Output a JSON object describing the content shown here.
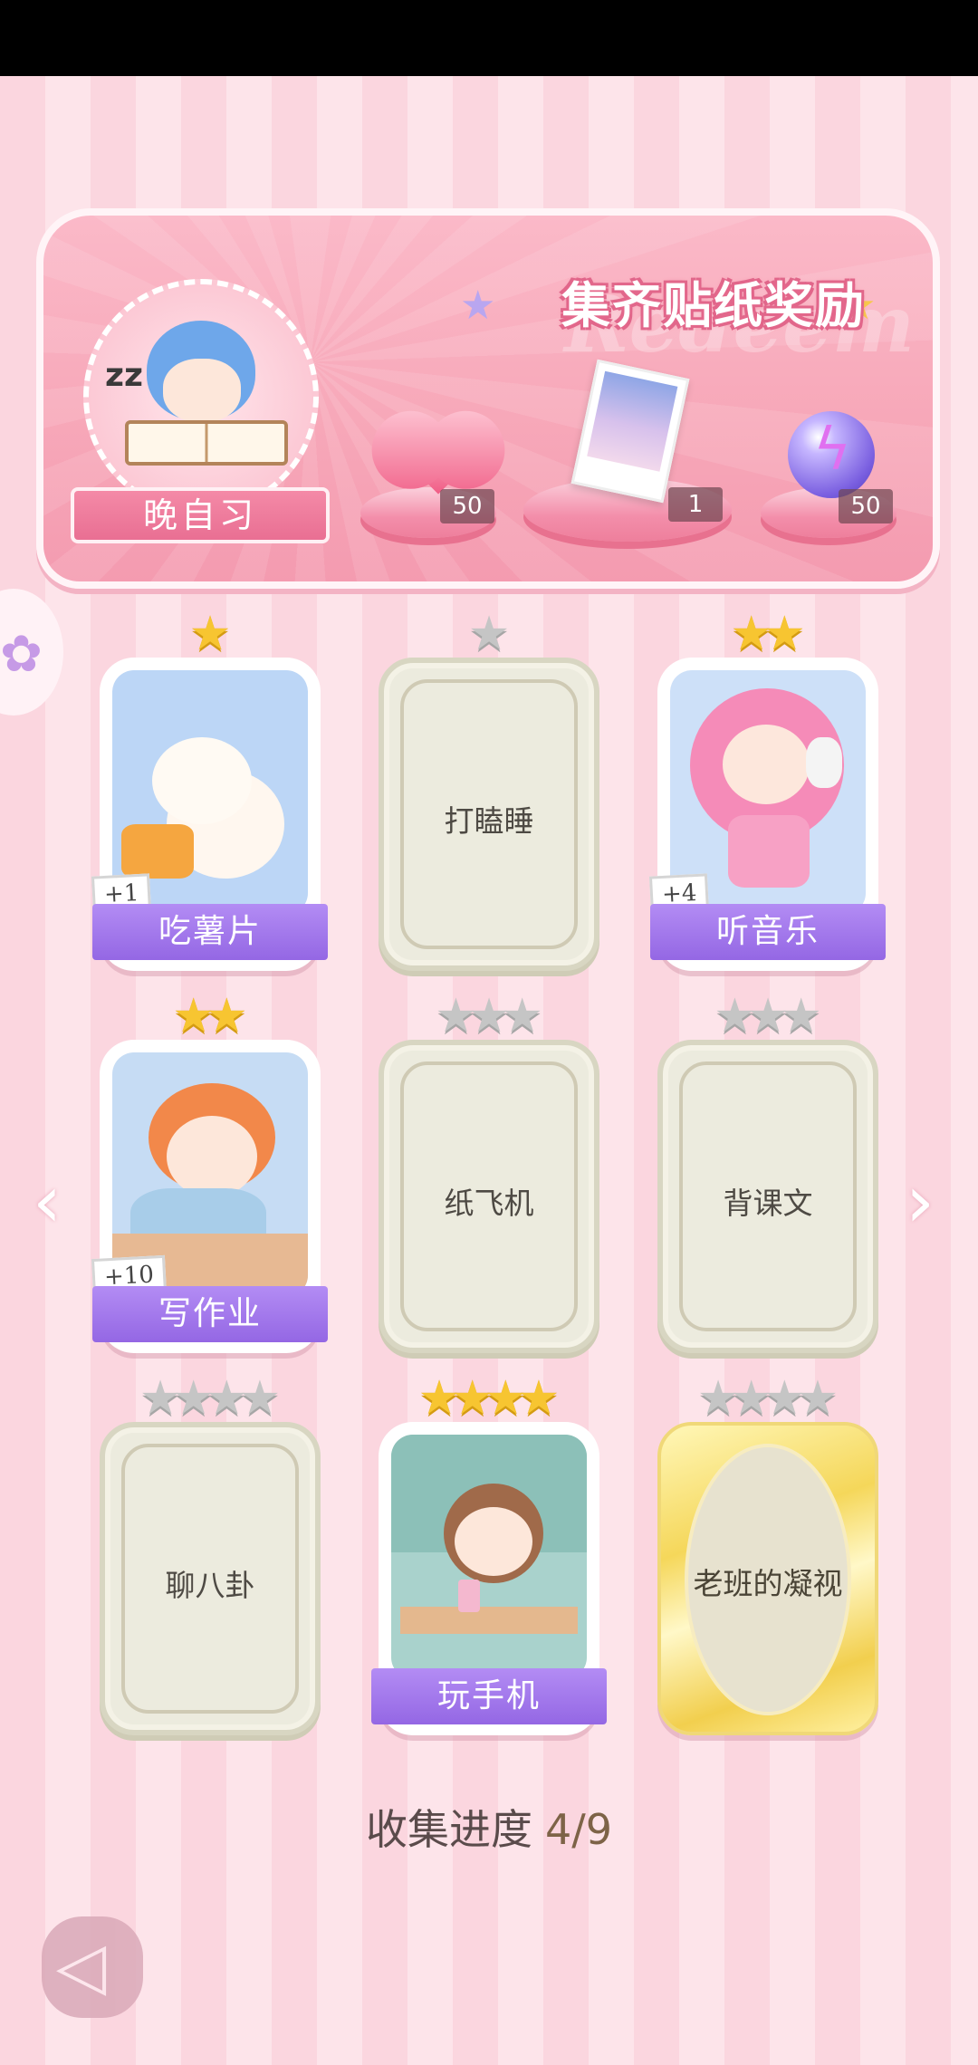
{
  "reward_panel": {
    "title": "集齐贴纸奖励",
    "watermark": "Redeem",
    "theme_label": "晚自习",
    "rewards": [
      {
        "item": "pink-heart-gem",
        "count": "50"
      },
      {
        "item": "photo-card",
        "count": "1"
      },
      {
        "item": "purple-energy-orb",
        "count": "50"
      }
    ]
  },
  "cards": [
    {
      "name": "吃薯片",
      "stars_filled": 1,
      "stars_total": 1,
      "collected": true,
      "bonus": "+1"
    },
    {
      "name": "打瞌睡",
      "stars_filled": 0,
      "stars_total": 1,
      "collected": false
    },
    {
      "name": "听音乐",
      "stars_filled": 2,
      "stars_total": 2,
      "collected": true,
      "bonus": "+4"
    },
    {
      "name": "写作业",
      "stars_filled": 2,
      "stars_total": 2,
      "collected": true,
      "bonus": "+10"
    },
    {
      "name": "纸飞机",
      "stars_filled": 0,
      "stars_total": 3,
      "collected": false
    },
    {
      "name": "背课文",
      "stars_filled": 0,
      "stars_total": 3,
      "collected": false
    },
    {
      "name": "聊八卦",
      "stars_filled": 0,
      "stars_total": 4,
      "collected": false
    },
    {
      "name": "玩手机",
      "stars_filled": 4,
      "stars_total": 4,
      "collected": true
    },
    {
      "name": "老班的凝视",
      "stars_filled": 0,
      "stars_total": 4,
      "collected": false,
      "special": "gold"
    }
  ],
  "progress": {
    "label": "收集进度",
    "count": "4/9"
  },
  "icons": {
    "prev": "chevron-left-icon",
    "next": "chevron-right-icon",
    "back": "back-icon"
  },
  "colors": {
    "label_purple": "#9467e4",
    "panel_pink": "#f7a8b9",
    "star_gold": "#f7c531",
    "star_grey": "#c5c5c5"
  }
}
